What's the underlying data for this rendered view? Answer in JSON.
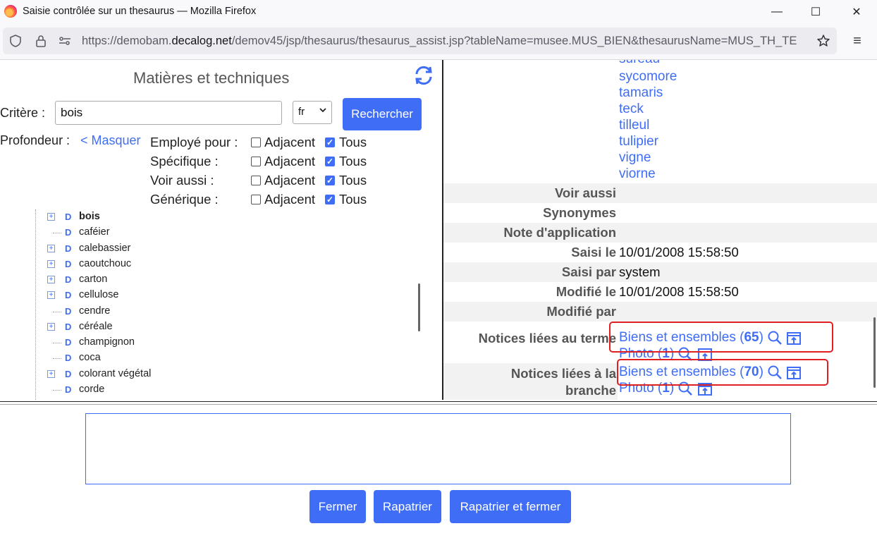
{
  "window": {
    "title": "Saisie contrôlée sur un thesaurus — Mozilla Firefox",
    "minimize": "—",
    "maximize": "☐",
    "close": "✕"
  },
  "browser": {
    "url_prefix": "https://demobam.",
    "url_domain": "decalog.net",
    "url_rest": "/demov45/jsp/thesaurus/thesaurus_assist.jsp?tableName=musee.MUS_BIEN&thesaurusName=MUS_TH_TE",
    "menu": "≡"
  },
  "left": {
    "title": "Matières et techniques",
    "criteria_label": "Critère :",
    "criteria_value": "bois",
    "lang_value": "fr",
    "search_button": "Rechercher",
    "depth_label": "Profondeur :",
    "hide_link": "< Masquer",
    "relations": [
      {
        "label": "Employé pour :",
        "adjacent": "Adjacent",
        "all": "Tous"
      },
      {
        "label": "Spécifique :",
        "adjacent": "Adjacent",
        "all": "Tous"
      },
      {
        "label": "Voir aussi :",
        "adjacent": "Adjacent",
        "all": "Tous"
      },
      {
        "label": "Générique :",
        "adjacent": "Adjacent",
        "all": "Tous"
      }
    ],
    "tree": [
      {
        "label": "bois",
        "expandable": true,
        "bold": true
      },
      {
        "label": "caféier",
        "expandable": false
      },
      {
        "label": "calebassier",
        "expandable": true
      },
      {
        "label": "caoutchouc",
        "expandable": true
      },
      {
        "label": "carton",
        "expandable": true
      },
      {
        "label": "cellulose",
        "expandable": true
      },
      {
        "label": "cendre",
        "expandable": false
      },
      {
        "label": "céréale",
        "expandable": true
      },
      {
        "label": "champignon",
        "expandable": false
      },
      {
        "label": "coca",
        "expandable": false
      },
      {
        "label": "colorant végétal",
        "expandable": true
      },
      {
        "label": "corde",
        "expandable": false
      }
    ]
  },
  "right": {
    "specific_terms": [
      "sureau",
      "sycomore",
      "tamaris",
      "teck",
      "tilleul",
      "tulipier",
      "vigne",
      "viorne"
    ],
    "props": [
      {
        "key": "Voir aussi",
        "value": ""
      },
      {
        "key": "Synonymes",
        "value": ""
      },
      {
        "key": "Note d'application",
        "value": ""
      },
      {
        "key": "Saisi le",
        "value": "10/01/2008 15:58:50"
      },
      {
        "key": "Saisi par",
        "value": "system"
      },
      {
        "key": "Modifié le",
        "value": "10/01/2008 15:58:50"
      },
      {
        "key": "Modifié par",
        "value": ""
      }
    ],
    "notices_term": {
      "key": "Notices liées au terme",
      "biens_label": "Biens et ensembles",
      "biens_open": " (",
      "biens_count": "65",
      "biens_close": ")",
      "photo_label": "Photo",
      "photo_open": " (",
      "photo_count": "1",
      "photo_close": ")"
    },
    "notices_branch": {
      "key_line1": "Notices liées à la",
      "key_line2": "branche",
      "biens_label": "Biens et ensembles",
      "biens_open": " (",
      "biens_count": "70",
      "biens_close": ")",
      "photo_label": "Photo",
      "photo_open": " (",
      "photo_count": "1",
      "photo_close": ")"
    }
  },
  "bottom": {
    "close_button": "Fermer",
    "import_button": "Rapatrier",
    "import_close_button": "Rapatrier et fermer"
  },
  "colors": {
    "accent": "#3f6df5",
    "highlight": "#e02020"
  }
}
